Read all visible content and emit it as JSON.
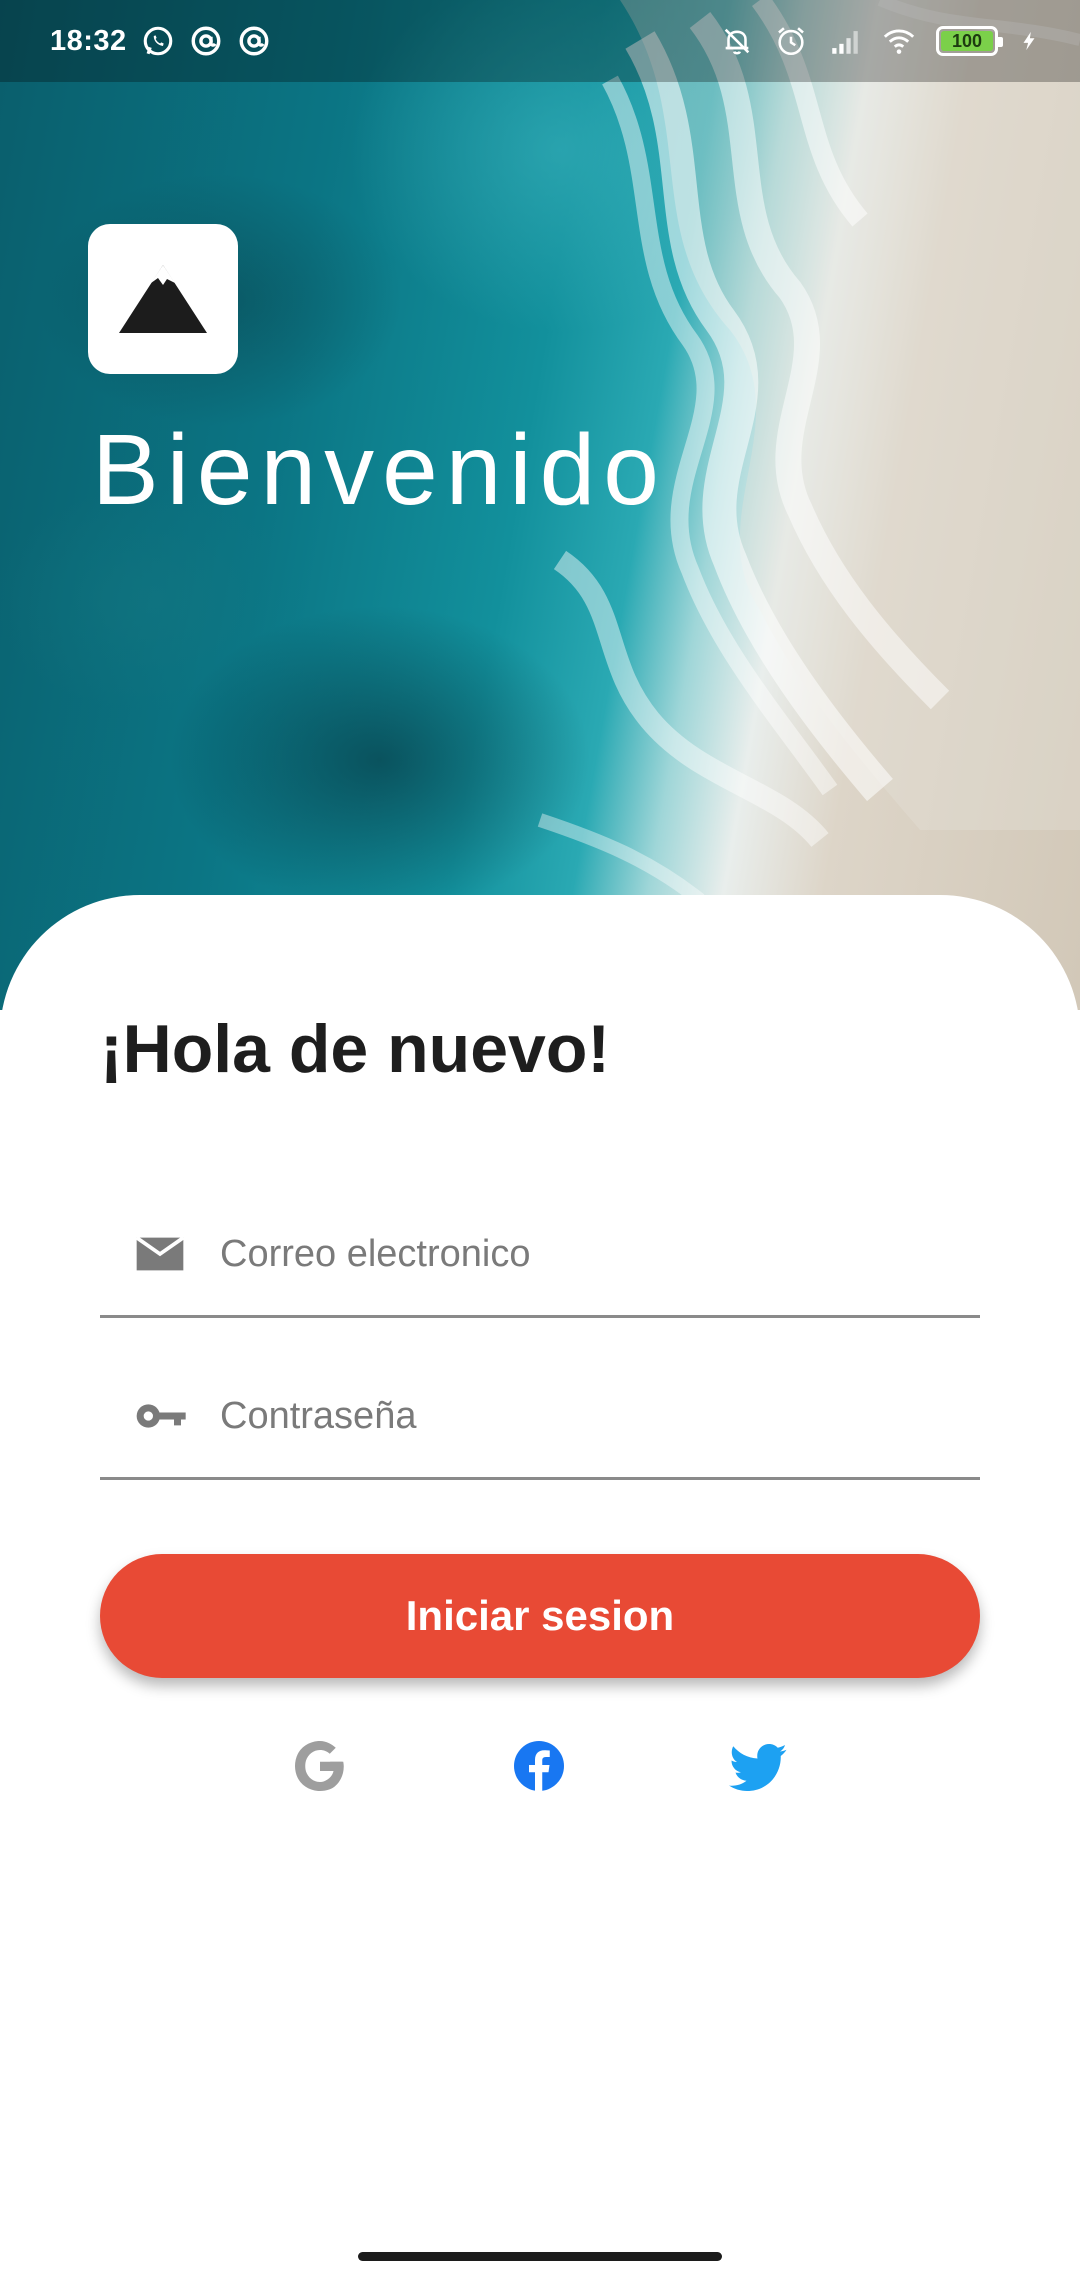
{
  "status_bar": {
    "time": "18:32",
    "battery": "100",
    "battery_level": 1.0,
    "left_icons": [
      "whatsapp-icon",
      "at-sign-icon",
      "at-sign-icon"
    ],
    "right_icons": [
      "notifications-off-icon",
      "alarm-icon",
      "signal-icon",
      "wifi-icon",
      "battery-icon",
      "charging-icon"
    ]
  },
  "hero": {
    "title": "Bienvenido",
    "logo_icon": "mountain-icon"
  },
  "login": {
    "greeting": "¡Hola de nuevo!",
    "email_placeholder": "Correo electronico",
    "email_value": "",
    "email_icon": "mail-icon",
    "password_placeholder": "Contraseña",
    "password_value": "",
    "password_icon": "key-icon",
    "submit_label": "Iniciar sesion"
  },
  "social_login": [
    {
      "name": "google",
      "icon": "google-icon",
      "color": "#9e9e9e"
    },
    {
      "name": "facebook",
      "icon": "facebook-icon",
      "color": "#1877f2"
    },
    {
      "name": "twitter",
      "icon": "twitter-icon",
      "color": "#1da1f2"
    }
  ],
  "colors": {
    "primary": "#e84a35",
    "text_dark": "#1e1e1e",
    "placeholder": "#7a7a7a",
    "facebook": "#1877f2",
    "twitter": "#1da1f2"
  }
}
